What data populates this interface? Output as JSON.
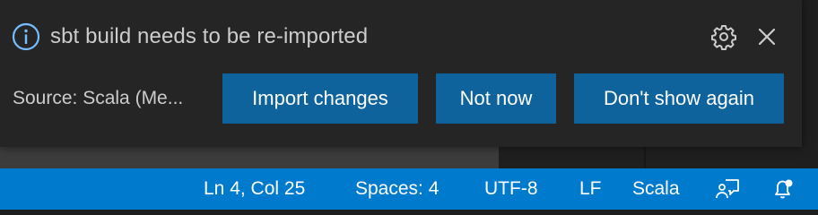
{
  "notification": {
    "message": "sbt build needs to be re-imported",
    "source": "Source: Scala (Me...",
    "buttons": {
      "import": "Import changes",
      "not_now": "Not now",
      "dont_show": "Don't show again"
    },
    "icons": {
      "info": "info-icon",
      "settings": "gear-icon",
      "close": "close-icon"
    }
  },
  "status_bar": {
    "position": "Ln 4, Col 25",
    "indentation": "Spaces: 4",
    "encoding": "UTF-8",
    "eol": "LF",
    "language": "Scala",
    "icons": {
      "feedback": "feedback-icon",
      "notifications": "bell-icon"
    }
  },
  "colors": {
    "accent": "#007acc",
    "button": "#0e639c",
    "notification_bg": "#252526",
    "info": "#75beff"
  }
}
